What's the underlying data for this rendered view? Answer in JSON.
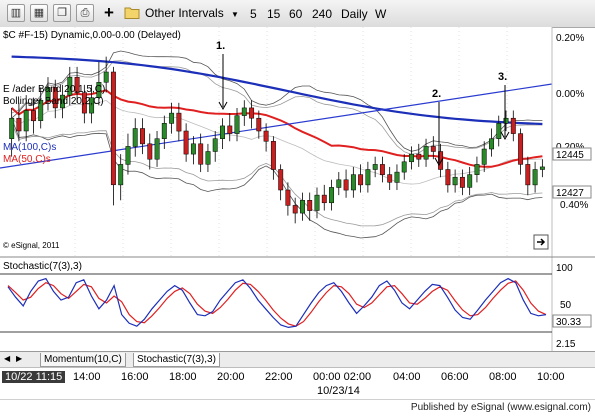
{
  "toolbar": {
    "interval_menu_label": "Other Intervals",
    "intervals": [
      "5",
      "15",
      "60",
      "240",
      "Daily",
      "W"
    ]
  },
  "chart": {
    "symbol_title": "$C #F-15) Dynamic,0.00-0.00 (Delayed)",
    "legend_lines": [
      "E  /ader Band 20,1.5,C)",
      "Bollinger Band 20,2,C)",
      "MA(100,C)s",
      "MA(50,C)s"
    ],
    "copyright": "© eSignal, 2011",
    "annotations": [
      "1.",
      "2.",
      "3."
    ],
    "price_axis": [
      "0.20%",
      "0.00%",
      "0.20%",
      "0.40%"
    ],
    "price_badges": [
      "12445",
      "12427"
    ],
    "colors": {
      "ma100": "#1c2fb8",
      "ma50": "#e02020",
      "trendline": "#2a3bd0",
      "up": "#2a8a2a",
      "down": "#c62020"
    }
  },
  "stochastic": {
    "title": "Stochastic(7(3),3)",
    "levels": [
      "100",
      "50",
      "30.33",
      "2.15"
    ]
  },
  "tabs": [
    "Momentum(10,C)",
    "Stochastic(7(3),3)"
  ],
  "time_axis": {
    "labels": [
      "10/22 11:15",
      "14:00",
      "16:00",
      "18:00",
      "20:00",
      "22:00",
      "00:00 02:00",
      "04:00",
      "06:00",
      "08:00",
      "10:00"
    ],
    "date_label": "10/23/14"
  },
  "footer": "Published by eSignal (www.esignal.com)",
  "candles": [
    {
      "o": 12438,
      "c": 12446,
      "h": 12450,
      "l": 12431
    },
    {
      "o": 12446,
      "c": 12441,
      "h": 12452,
      "l": 12437
    },
    {
      "o": 12441,
      "c": 12449,
      "h": 12455,
      "l": 12437
    },
    {
      "o": 12449,
      "c": 12445,
      "h": 12454,
      "l": 12440
    },
    {
      "o": 12445,
      "c": 12453,
      "h": 12458,
      "l": 12442
    },
    {
      "o": 12453,
      "c": 12458,
      "h": 12462,
      "l": 12449
    },
    {
      "o": 12458,
      "c": 12450,
      "h": 12461,
      "l": 12446
    },
    {
      "o": 12450,
      "c": 12455,
      "h": 12459,
      "l": 12446
    },
    {
      "o": 12455,
      "c": 12462,
      "h": 12466,
      "l": 12451
    },
    {
      "o": 12462,
      "c": 12456,
      "h": 12466,
      "l": 12452
    },
    {
      "o": 12456,
      "c": 12448,
      "h": 12459,
      "l": 12444
    },
    {
      "o": 12448,
      "c": 12454,
      "h": 12459,
      "l": 12444
    },
    {
      "o": 12454,
      "c": 12460,
      "h": 12468,
      "l": 12451
    },
    {
      "o": 12460,
      "c": 12464,
      "h": 12470,
      "l": 12456
    },
    {
      "o": 12464,
      "c": 12420,
      "h": 12466,
      "l": 12412
    },
    {
      "o": 12420,
      "c": 12428,
      "h": 12432,
      "l": 12414
    },
    {
      "o": 12428,
      "c": 12435,
      "h": 12440,
      "l": 12424
    },
    {
      "o": 12435,
      "c": 12442,
      "h": 12446,
      "l": 12431
    },
    {
      "o": 12442,
      "c": 12436,
      "h": 12446,
      "l": 12432
    },
    {
      "o": 12436,
      "c": 12430,
      "h": 12440,
      "l": 12426
    },
    {
      "o": 12430,
      "c": 12438,
      "h": 12441,
      "l": 12427
    },
    {
      "o": 12438,
      "c": 12444,
      "h": 12447,
      "l": 12434
    },
    {
      "o": 12444,
      "c": 12448,
      "h": 12452,
      "l": 12440
    },
    {
      "o": 12448,
      "c": 12441,
      "h": 12452,
      "l": 12437
    },
    {
      "o": 12441,
      "c": 12432,
      "h": 12444,
      "l": 12429
    },
    {
      "o": 12432,
      "c": 12436,
      "h": 12439,
      "l": 12428
    },
    {
      "o": 12436,
      "c": 12428,
      "h": 12440,
      "l": 12425
    },
    {
      "o": 12428,
      "c": 12433,
      "h": 12436,
      "l": 12425
    },
    {
      "o": 12433,
      "c": 12438,
      "h": 12441,
      "l": 12429
    },
    {
      "o": 12438,
      "c": 12443,
      "h": 12446,
      "l": 12434
    },
    {
      "o": 12443,
      "c": 12440,
      "h": 12448,
      "l": 12437
    },
    {
      "o": 12440,
      "c": 12447,
      "h": 12450,
      "l": 12437
    },
    {
      "o": 12447,
      "c": 12450,
      "h": 12453,
      "l": 12443
    },
    {
      "o": 12450,
      "c": 12446,
      "h": 12453,
      "l": 12442
    },
    {
      "o": 12446,
      "c": 12441,
      "h": 12449,
      "l": 12438
    },
    {
      "o": 12441,
      "c": 12437,
      "h": 12444,
      "l": 12433
    },
    {
      "o": 12437,
      "c": 12426,
      "h": 12439,
      "l": 12422
    },
    {
      "o": 12426,
      "c": 12418,
      "h": 12428,
      "l": 12414
    },
    {
      "o": 12418,
      "c": 12412,
      "h": 12421,
      "l": 12408
    },
    {
      "o": 12412,
      "c": 12409,
      "h": 12415,
      "l": 12405
    },
    {
      "o": 12409,
      "c": 12414,
      "h": 12417,
      "l": 12406
    },
    {
      "o": 12414,
      "c": 12410,
      "h": 12417,
      "l": 12406
    },
    {
      "o": 12410,
      "c": 12416,
      "h": 12419,
      "l": 12407
    },
    {
      "o": 12416,
      "c": 12413,
      "h": 12420,
      "l": 12410
    },
    {
      "o": 12413,
      "c": 12419,
      "h": 12422,
      "l": 12410
    },
    {
      "o": 12419,
      "c": 12422,
      "h": 12425,
      "l": 12416
    },
    {
      "o": 12422,
      "c": 12418,
      "h": 12426,
      "l": 12415
    },
    {
      "o": 12418,
      "c": 12424,
      "h": 12427,
      "l": 12415
    },
    {
      "o": 12424,
      "c": 12420,
      "h": 12428,
      "l": 12417
    },
    {
      "o": 12420,
      "c": 12426,
      "h": 12429,
      "l": 12417
    },
    {
      "o": 12426,
      "c": 12428,
      "h": 12431,
      "l": 12423
    },
    {
      "o": 12428,
      "c": 12424,
      "h": 12431,
      "l": 12421
    },
    {
      "o": 12424,
      "c": 12421,
      "h": 12427,
      "l": 12418
    },
    {
      "o": 12421,
      "c": 12425,
      "h": 12428,
      "l": 12418
    },
    {
      "o": 12425,
      "c": 12429,
      "h": 12432,
      "l": 12422
    },
    {
      "o": 12429,
      "c": 12432,
      "h": 12435,
      "l": 12426
    },
    {
      "o": 12432,
      "c": 12430,
      "h": 12436,
      "l": 12427
    },
    {
      "o": 12430,
      "c": 12435,
      "h": 12438,
      "l": 12427
    },
    {
      "o": 12435,
      "c": 12433,
      "h": 12439,
      "l": 12430
    },
    {
      "o": 12433,
      "c": 12426,
      "h": 12436,
      "l": 12423
    },
    {
      "o": 12426,
      "c": 12420,
      "h": 12429,
      "l": 12417
    },
    {
      "o": 12420,
      "c": 12423,
      "h": 12426,
      "l": 12417
    },
    {
      "o": 12423,
      "c": 12419,
      "h": 12426,
      "l": 12416
    },
    {
      "o": 12419,
      "c": 12424,
      "h": 12427,
      "l": 12416
    },
    {
      "o": 12424,
      "c": 12428,
      "h": 12431,
      "l": 12421
    },
    {
      "o": 12428,
      "c": 12434,
      "h": 12437,
      "l": 12425
    },
    {
      "o": 12434,
      "c": 12438,
      "h": 12442,
      "l": 12431
    },
    {
      "o": 12438,
      "c": 12444,
      "h": 12447,
      "l": 12435
    },
    {
      "o": 12444,
      "c": 12446,
      "h": 12449,
      "l": 12441
    },
    {
      "o": 12446,
      "c": 12440,
      "h": 12449,
      "l": 12437
    },
    {
      "o": 12440,
      "c": 12428,
      "h": 12442,
      "l": 12424
    },
    {
      "o": 12428,
      "c": 12420,
      "h": 12431,
      "l": 12416
    },
    {
      "o": 12420,
      "c": 12426,
      "h": 12429,
      "l": 12417
    },
    {
      "o": 12426,
      "c": 12427,
      "h": 12430,
      "l": 12423
    }
  ],
  "stoch_k": [
    78,
    60,
    45,
    70,
    88,
    92,
    70,
    55,
    60,
    85,
    90,
    62,
    40,
    55,
    80,
    30,
    15,
    10,
    22,
    40,
    55,
    70,
    80,
    72,
    50,
    30,
    28,
    35,
    55,
    70,
    85,
    90,
    75,
    55,
    40,
    25,
    12,
    8,
    10,
    30,
    50,
    68,
    80,
    85,
    70,
    50,
    32,
    45,
    60,
    80,
    88,
    72,
    50,
    40,
    55,
    70,
    82,
    80,
    60,
    38,
    25,
    22,
    38,
    55,
    70,
    85,
    92,
    85,
    55,
    32,
    28,
    30
  ],
  "stoch_d": [
    80,
    68,
    55,
    60,
    75,
    85,
    80,
    66,
    58,
    70,
    82,
    78,
    58,
    50,
    62,
    52,
    30,
    18,
    16,
    28,
    42,
    58,
    70,
    76,
    66,
    48,
    36,
    32,
    42,
    56,
    72,
    84,
    82,
    70,
    55,
    38,
    24,
    14,
    10,
    18,
    34,
    52,
    68,
    80,
    78,
    66,
    48,
    42,
    50,
    64,
    78,
    80,
    66,
    50,
    48,
    58,
    70,
    78,
    72,
    54,
    38,
    28,
    30,
    42,
    58,
    72,
    84,
    88,
    72,
    50,
    36,
    30
  ]
}
